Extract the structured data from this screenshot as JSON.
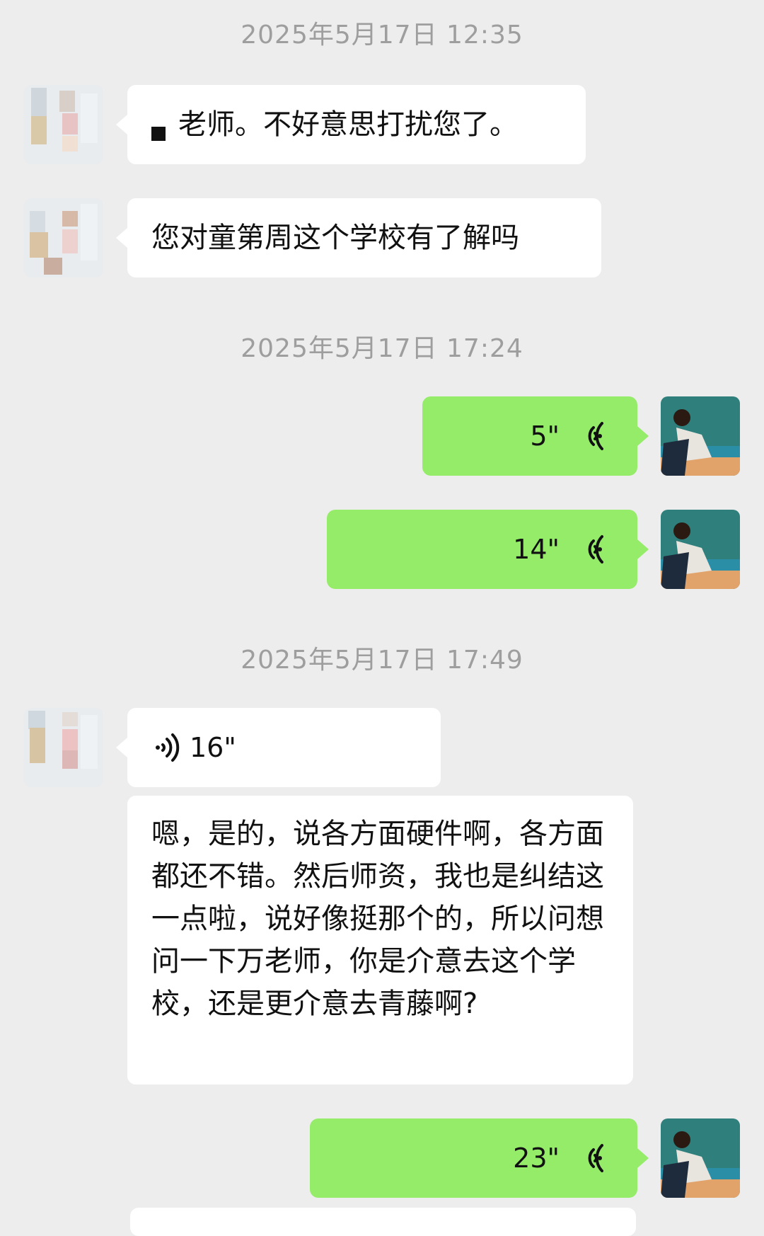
{
  "timestamps": [
    "2025年5月17日 12:35",
    "2025年5月17日 17:24",
    "2025年5月17日 17:49"
  ],
  "messages": {
    "m1": "老师。不好意思打扰您了。",
    "m2": "您对童第周这个学校有了解吗",
    "v1": "5\"",
    "v2": "14\"",
    "v3": "16\"",
    "m3": "嗯，是的，说各方面硬件啊，各方面都还不错。然后师资，我也是纠结这一点啦，说好像挺那个的，所以问想问一下万老师，你是介意去这个学校，还是更介意去青藤啊?",
    "v4": "23\""
  },
  "colors": {
    "background": "#ededed",
    "outgoing_bubble": "#95ec69",
    "incoming_bubble": "#ffffff",
    "timestamp": "#9e9e9e"
  },
  "icons": [
    "voice-wave-icon",
    "avatar-contact",
    "avatar-self"
  ]
}
